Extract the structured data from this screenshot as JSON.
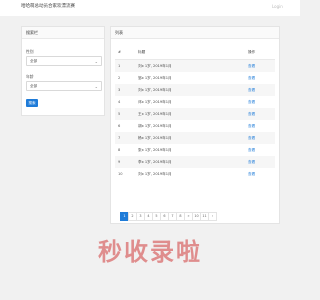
{
  "header": {
    "title": "哈哈萌总动员合家欢漂流赛",
    "login": "Login"
  },
  "search_panel": {
    "title": "搜索栏",
    "field1": {
      "label": "性别",
      "value": "全部"
    },
    "field2": {
      "label": "年龄",
      "value": "全部"
    },
    "button": "搜索"
  },
  "list_panel": {
    "title": "列表",
    "columns": [
      "#",
      "标题",
      "操作"
    ],
    "rows": [
      {
        "idx": "1",
        "name": "刘x 1岁, 2019年1月",
        "op": "查看"
      },
      {
        "idx": "2",
        "name": "邹x 1岁, 2019年1月",
        "op": "查看"
      },
      {
        "idx": "3",
        "name": "刘x 1岁, 2019年1月",
        "op": "查看"
      },
      {
        "idx": "4",
        "name": "邓x 1岁, 2019年1月",
        "op": "查看"
      },
      {
        "idx": "5",
        "name": "王x 1岁, 2019年1月",
        "op": "查看"
      },
      {
        "idx": "6",
        "name": "胡x 1岁, 2019年1月",
        "op": "查看"
      },
      {
        "idx": "7",
        "name": "杨x 1岁, 2019年1月",
        "op": "查看"
      },
      {
        "idx": "8",
        "name": "张x 1岁, 2019年1月",
        "op": "查看"
      },
      {
        "idx": "9",
        "name": "李x 1岁, 2019年1月",
        "op": "查看"
      },
      {
        "idx": "10",
        "name": "刘x 1岁, 2019年1月",
        "op": "查看"
      }
    ],
    "pagination": [
      "1",
      "2",
      "3",
      "4",
      "5",
      "6",
      "7",
      "8",
      "»",
      "10",
      "11",
      "›"
    ],
    "active_page": "1"
  },
  "watermark": "秒收录啦",
  "colors": {
    "accent": "#1e7bd8",
    "watermark": "#d23c3c"
  }
}
